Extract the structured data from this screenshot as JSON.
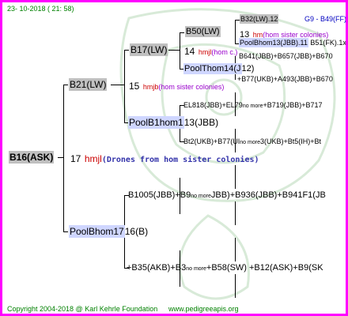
{
  "header": {
    "timestamp": "23- 10-2018 ( 21: 58)"
  },
  "footer": {
    "copyright": "Copyright 2004-2018 @ Karl Kehrle Foundation",
    "website": "www.pedigreeapis.org"
  },
  "colors": {
    "border": "#ff00ff",
    "green": "#008000",
    "grey_box": "#c0c0c0",
    "drone_text": "#3333aa",
    "red": "#cc0000",
    "purple": "#9900cc"
  },
  "tree": {
    "root": {
      "name": "B16(ASK)",
      "year": "17",
      "breeder": "hmjl",
      "note": "(Drones from hom sister colonies)"
    },
    "dam": {
      "name": "B21(LW)",
      "year": "15",
      "breeder": "hmjb",
      "note": "(hom sister colonies)"
    },
    "sire": {
      "name": "PoolBhom17",
      "year": "16",
      "suffix": "(B)"
    },
    "dam_dam": {
      "name": "B17(LW)",
      "year": "14",
      "breeder": "hmjl",
      "note": "(hom c.)"
    },
    "dam_sire": {
      "name": "PoolB1hom1",
      "year": "13",
      "suffix": "(JBB)"
    },
    "dd_dam": {
      "name": "B50(LW)",
      "year": "13",
      "breeder": "hm",
      "note": "(hom sister colonies)"
    },
    "dd_sire": {
      "name": "PoolThom14(J",
      "year": "12",
      "suffix": ")"
    },
    "ddd_dam": {
      "name": "B32(LW).12"
    },
    "ddd_right": "G9 - B49(FF)",
    "ddd_sire": {
      "name": "PoolBhom13(JBB).11",
      "extra": "B51(FK).1x"
    },
    "dds_dam": "B641(JBB)+B657(JBB)+B670",
    "dds_sire": "+B77(UKB)+A493(JBB)+B670",
    "ds_dam": {
      "name": "EL818(JBB)+EL79",
      "more": "no more",
      "rest": "+B719(JBB)+B717"
    },
    "ds_sire": {
      "name": "Bt2(UKB)+B77(UI",
      "more": "no more",
      "rest": "3(UKB)+Bt5(IH)+Bt"
    },
    "s_dam": {
      "name": "B1005(JBB)+B9",
      "more": "no more",
      "rest": "JBB)+B936(JBB)+B941F1(JB"
    },
    "s_sire": {
      "name": "+B35(AKB)+B3",
      "more": "no more",
      "rest": "+B58(SW) +B12(ASK)+B9(SK"
    }
  }
}
